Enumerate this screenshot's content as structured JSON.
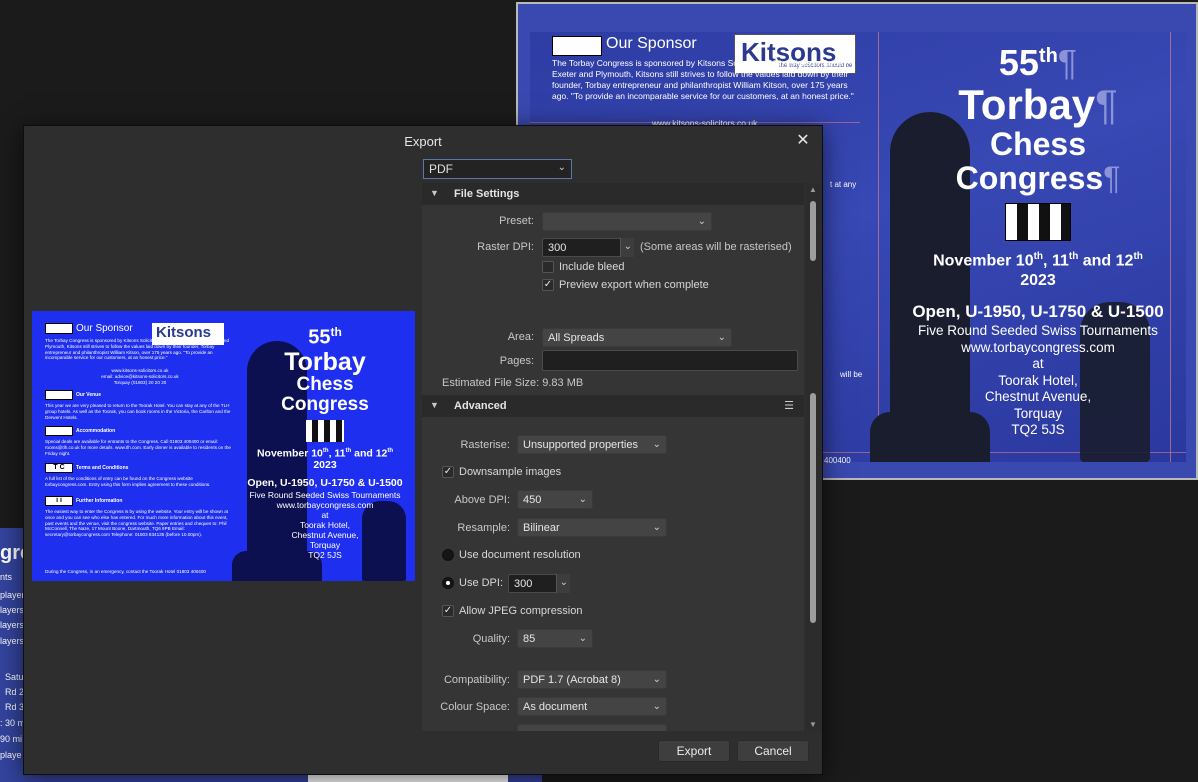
{
  "dialog": {
    "title": "Export",
    "close_glyph": "✕",
    "format": "PDF",
    "buttons": {
      "export": "Export",
      "cancel": "Cancel"
    }
  },
  "file_settings": {
    "header": "File Settings",
    "preset_label": "Preset:",
    "preset_value": "",
    "raster_dpi_label": "Raster DPI:",
    "raster_dpi_value": "300",
    "raster_note": "(Some areas will be rasterised)",
    "include_bleed": {
      "label": "Include bleed",
      "checked": false
    },
    "preview_export": {
      "label": "Preview export when complete",
      "checked": true
    },
    "area_label": "Area:",
    "area_value": "All Spreads",
    "pages_label": "Pages:",
    "pages_value": "",
    "estimated_size": "Estimated File Size: 9.83 MB"
  },
  "advanced": {
    "header": "Advanced",
    "rasterise_label": "Rasterise:",
    "rasterise_value": "Unsupported properties",
    "downsample": {
      "label": "Downsample images",
      "checked": true
    },
    "above_dpi_label": "Above DPI:",
    "above_dpi_value": "450",
    "resample_label": "Resample:",
    "resample_value": "Bilinear",
    "use_doc_res": {
      "label": "Use document resolution",
      "selected": false
    },
    "use_dpi": {
      "label": "Use DPI:",
      "selected": true,
      "value": "300"
    },
    "jpeg": {
      "label": "Allow JPEG compression",
      "checked": true
    },
    "quality_label": "Quality:",
    "quality_value": "85",
    "compat_label": "Compatibility:",
    "compat_value": "PDF 1.7 (Acrobat 8)",
    "colour_label": "Colour Space:",
    "colour_value": "As document"
  },
  "document": {
    "sponsor_title": "Our Sponsor",
    "logo": "Kitsons",
    "logo_tagline": "the way solicitors should be",
    "sponsor_text": "The Torbay Congress is sponsored by Kitsons Solicitors. With offices in Torbay, Exeter and Plymouth, Kitsons still strives to follow the values laid down by their founder, Torbay entrepreneur and philanthropist William Kitson, over 175 years ago. \"To provide an incomparable service for our customers, at an honest price.\"",
    "sponsor_url": "www.kitsons-solicitors.co.uk",
    "frag_at_any": "t at any",
    "frag_will_be": "will be",
    "frag_phone": "400400",
    "heading_55": "55",
    "heading_55_sup": "th",
    "heading_torbay": "Torbay",
    "heading_chess": "Chess",
    "heading_congress": "Congress",
    "dates_pre": "November 10",
    "dates_mid1": ", 11",
    "dates_mid2": " and 12",
    "sup_th": "th",
    "year": "2023",
    "divisions": "Open, U-1950, U-1750 & U-1500",
    "tournament": "Five Round Seeded Swiss Tournaments",
    "website": "www.torbaycongress.com",
    "at": "at",
    "venue": "Toorak Hotel,",
    "street": "Chestnut Avenue,",
    "town": "Torquay",
    "postcode": "TQ2 5JS",
    "pilcrow": "¶"
  },
  "preview": {
    "email": "www.kitsons-solicitors.co.uk\nemail: advice@kitsons-solicitors.co.uk\nTorquay (01803) 20 20 20",
    "venue_head": "Our Venue",
    "venue_text": "This year we are very pleased to return to the Toorak Hotel. You can stay at any of the TLH group hotels. As well as the Toorak, you can book rooms in the Victoria, the Carlton and the Derwent Hotels.",
    "accom_head": "Accommodation",
    "accom_text": "Special deals are available for entrants to the Congress. Call 01803 400400 or email: rooms@tlh.co.uk for more details. www.tlh.com. Early dinner is available to residents on the Friday night.",
    "tc_icon": "T C",
    "terms_head": "Terms and Conditions",
    "terms_text": "A full list of the conditions of entry can be found on the Congress website torbaycongress.com. Entry using this form implies agreement to these conditions.",
    "info_icon": "i i",
    "info_head": "Further Information",
    "info_text": "The easiest way to enter the Congress is by using the website. Your entry will be shown at once and you can see who else has entered. For much more information about this event, past events and the venue, visit the congress website. Paper entries and cheques to: Phil McConnell, The Naze, 17 Mount Boone, Dartmouth, TQ6 9PB Email: secretary@torbaycongress.com Telephone: 01803 834135 (before 10.00pm).",
    "emergency": "During the Congress, in an emergency, contact the Toorak Hotel 01803 400400"
  },
  "left_doc": {
    "lines": [
      "gre",
      "nts",
      "player",
      "layers",
      "layers",
      "layers",
      "Satu",
      "Rd 2",
      "Rd 3",
      ": 30 m",
      "90 mi",
      "playe"
    ]
  },
  "colors": {
    "accent_border": "#5a78a8",
    "doc_blue": "#3a49b0",
    "preview_blue": "#1f2ff0"
  }
}
